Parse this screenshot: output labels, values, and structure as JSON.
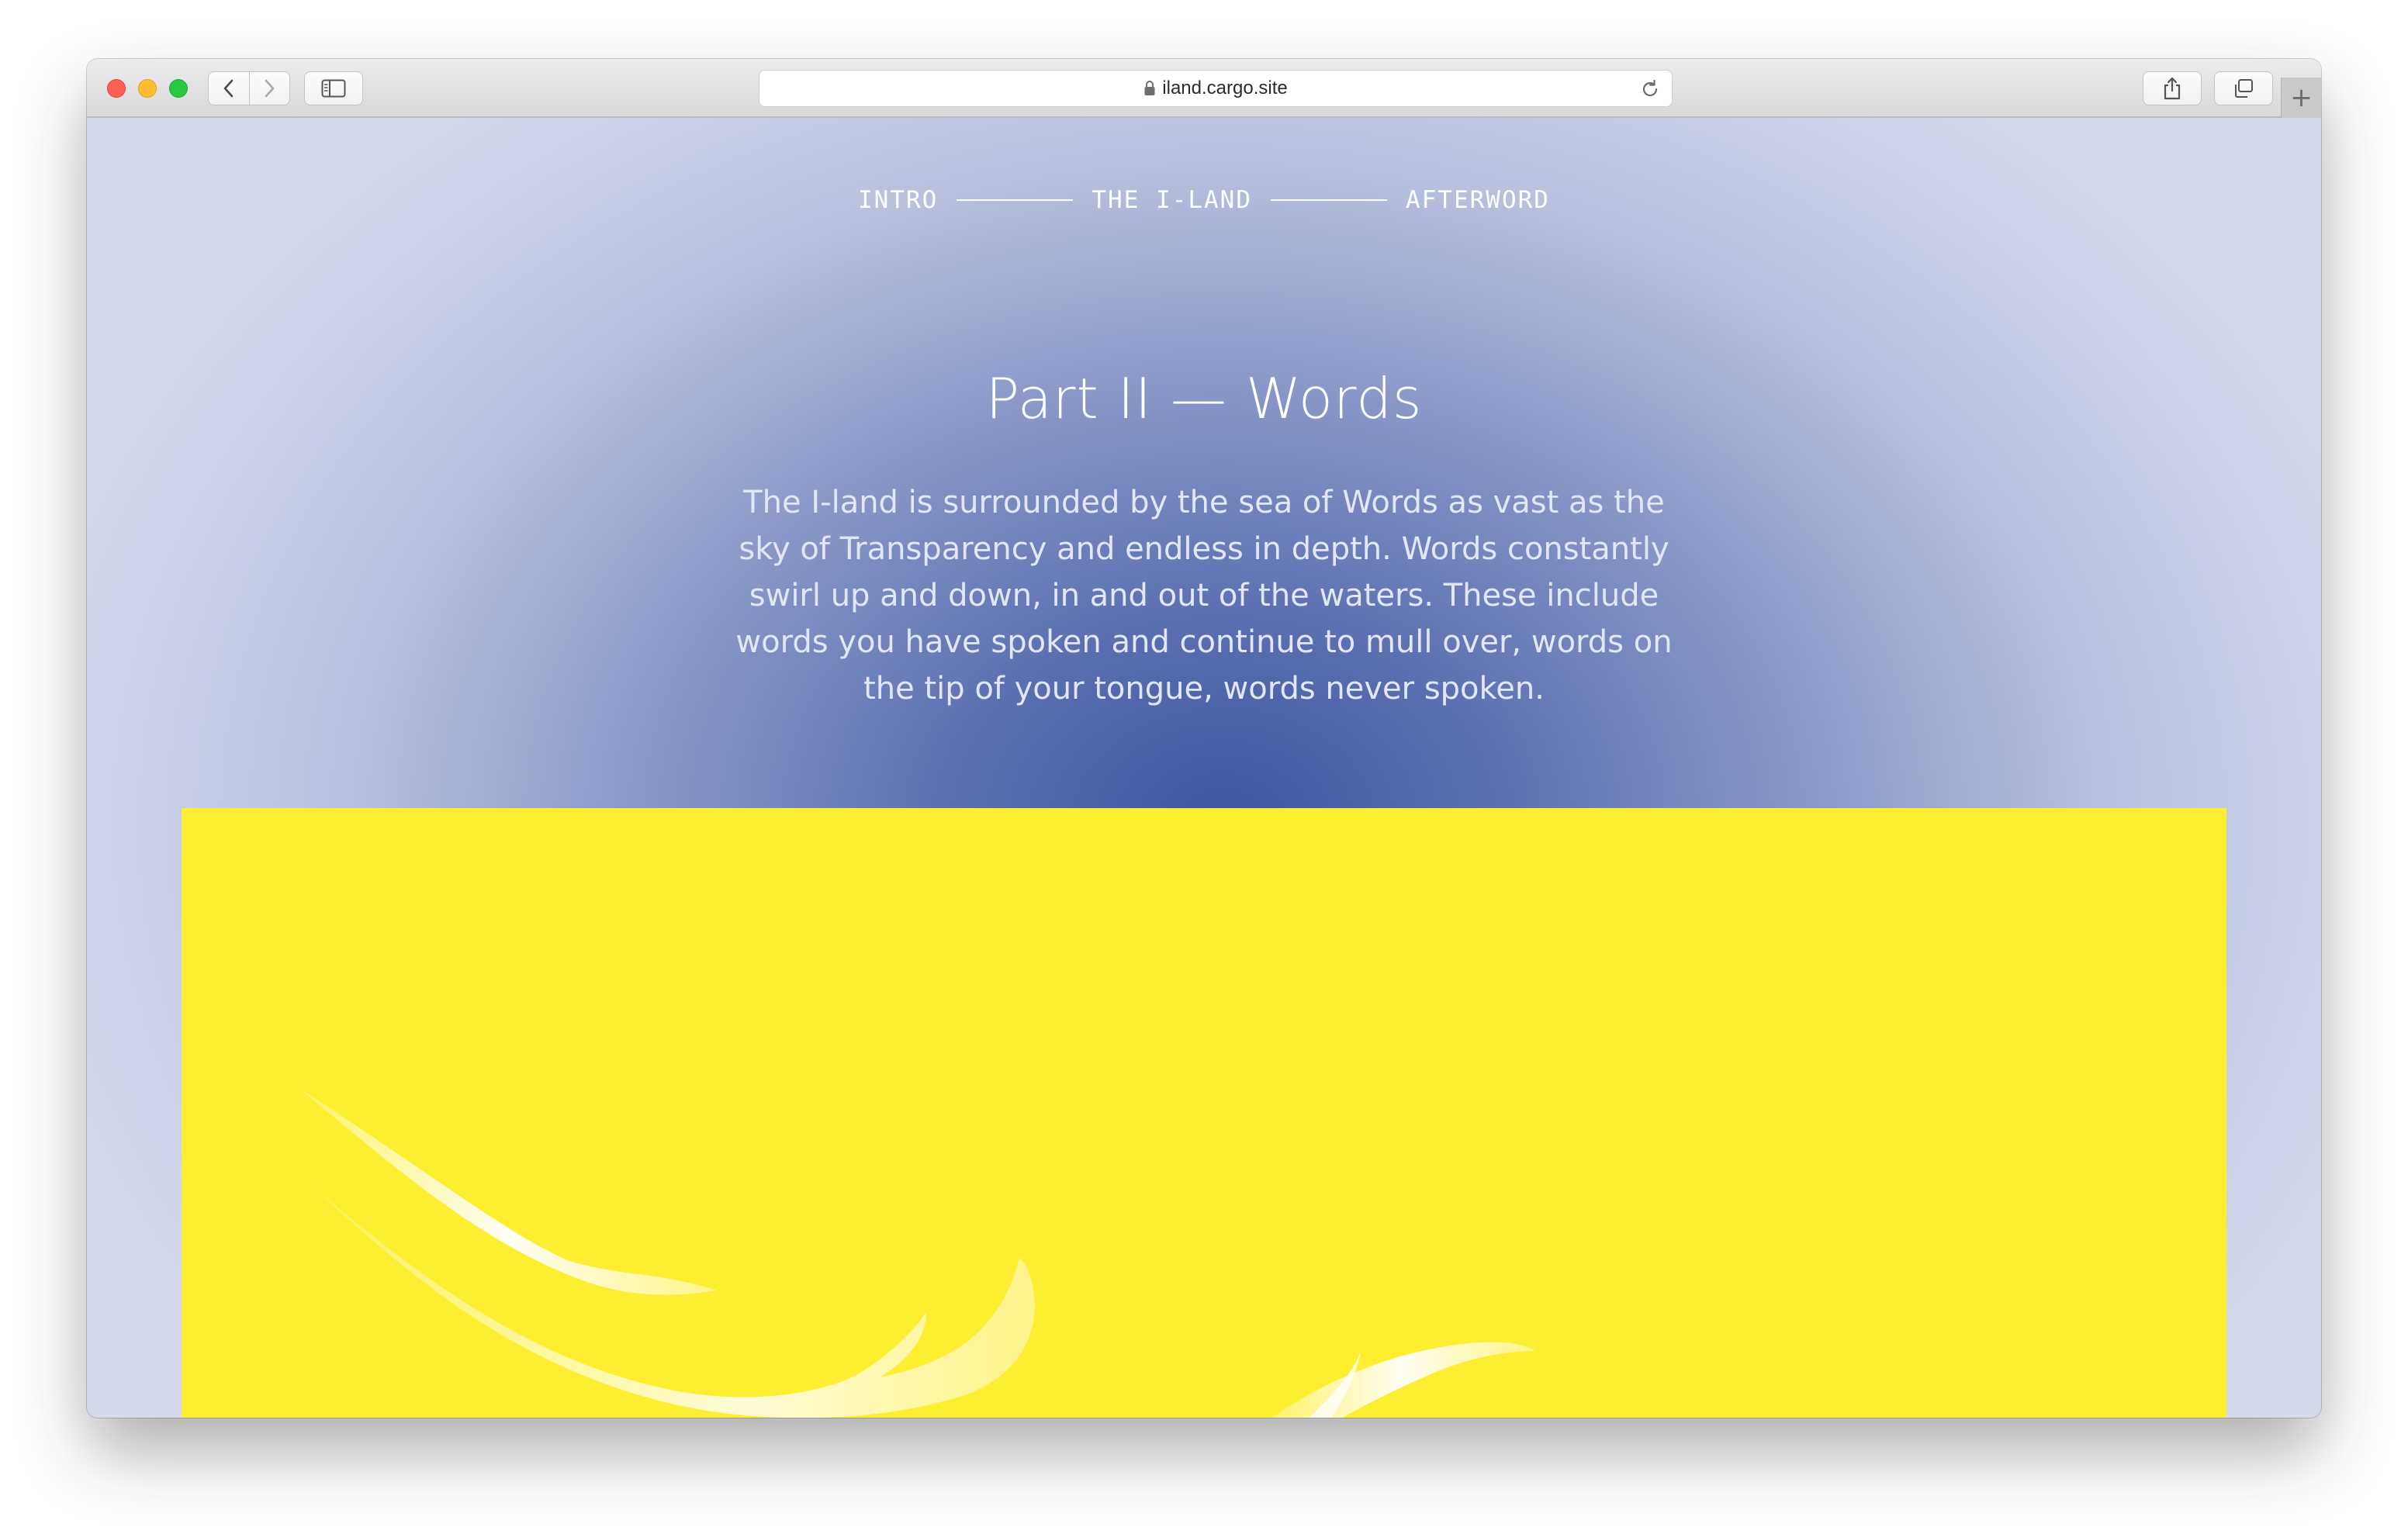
{
  "browser": {
    "url": "iland.cargo.site"
  },
  "nav": {
    "items": [
      "INTRO",
      "THE I-LAND",
      "AFTERWORD"
    ]
  },
  "section": {
    "title": "Part II — Words",
    "body": "The I-land is surrounded by the sea of Words as vast as the sky of Transparency and endless in depth. Words constantly swirl up and down, in and out of the waters. These include words you have spoken and continue to mull over, words on the tip of your tongue, words never spoken."
  },
  "colors": {
    "background_center": "#3c56a0",
    "background_edge": "#d4d9ec",
    "panel": "#fdee31"
  },
  "icons": [
    "lock-icon",
    "reload-icon",
    "back-icon",
    "forward-icon",
    "sidebar-icon",
    "share-icon",
    "tabs-icon",
    "new-tab-icon"
  ]
}
